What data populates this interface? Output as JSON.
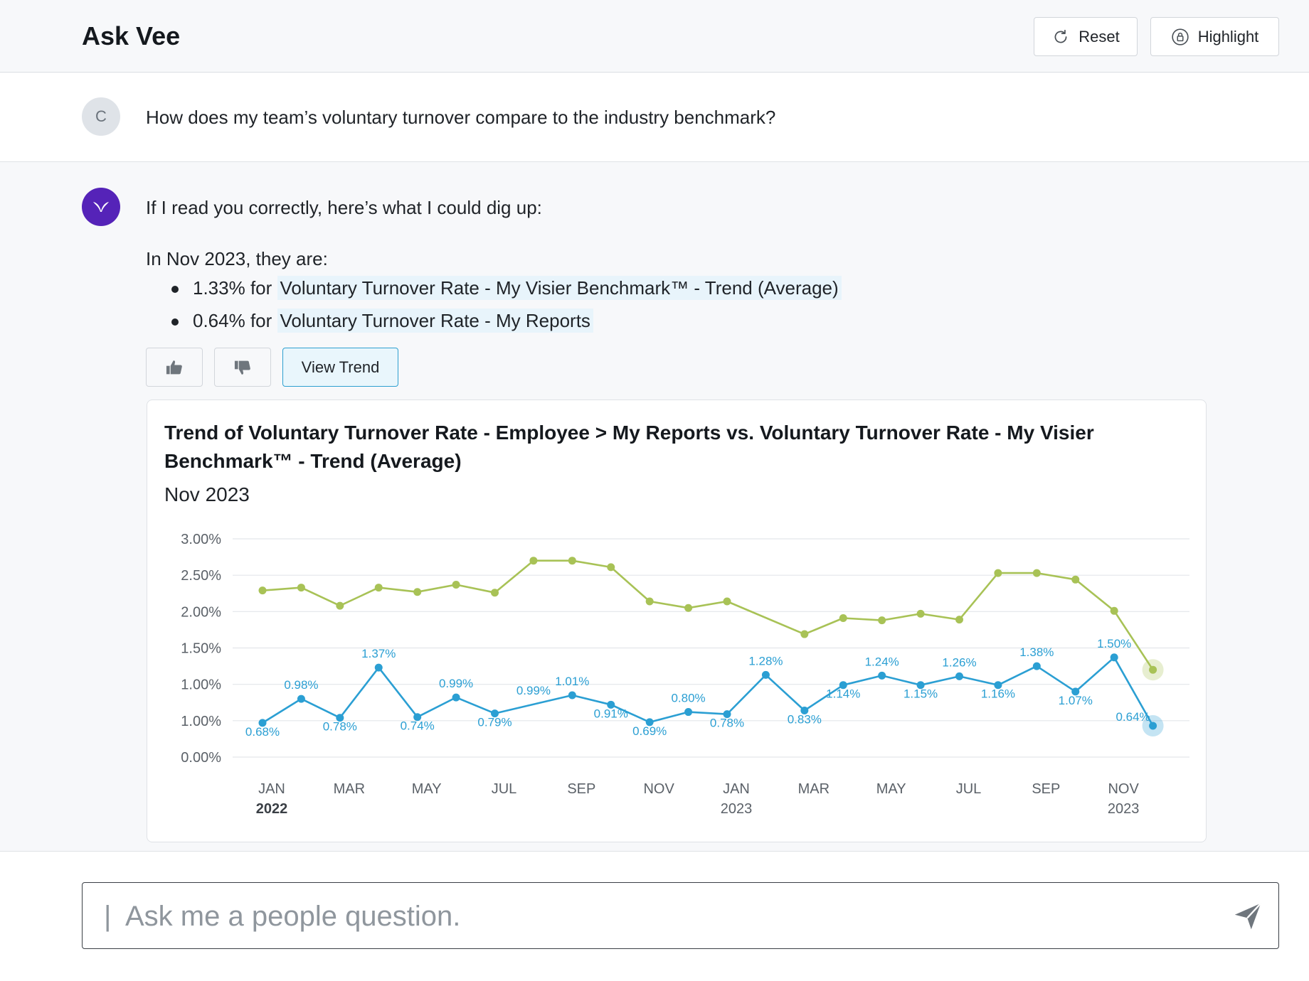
{
  "header": {
    "title": "Ask Vee",
    "reset_label": "Reset",
    "highlight_label": "Highlight"
  },
  "question": {
    "avatar_initial": "C",
    "text": "How does my team’s voluntary turnover compare to the industry benchmark?"
  },
  "answer": {
    "intro": "If I read you correctly, here’s what I could dig up:",
    "period_line": "In Nov 2023, they are:",
    "items": [
      {
        "value": "1.33% for ",
        "metric": "Voluntary Turnover Rate - My Visier Benchmark™ - Trend (Average)"
      },
      {
        "value": "0.64% for ",
        "metric": "Voluntary Turnover Rate - My Reports"
      }
    ],
    "view_trend_label": "View Trend"
  },
  "colors": {
    "benchmark": "#a8c256",
    "reports": "#2b9fd3",
    "brand": "#5523b8"
  },
  "icons": [
    "reset-icon",
    "lock-icon",
    "thumbs-up-icon",
    "thumbs-down-icon",
    "send-icon"
  ],
  "chart_data": {
    "type": "line",
    "title": "Trend of Voluntary Turnover Rate - Employee > My Reports vs. Voluntary Turnover Rate - My Visier Benchmark™ - Trend (Average)",
    "subtitle": "Nov 2023",
    "y_tick_labels": [
      "3.00%",
      "2.50%",
      "2.00%",
      "1.50%",
      "1.00%",
      "1.00%",
      "0.00%"
    ],
    "x_tick_labels": [
      {
        "month": "JAN",
        "year": "2022"
      },
      {
        "month": "MAR",
        "year": ""
      },
      {
        "month": "MAY",
        "year": ""
      },
      {
        "month": "JUL",
        "year": ""
      },
      {
        "month": "SEP",
        "year": ""
      },
      {
        "month": "NOV",
        "year": ""
      },
      {
        "month": "JAN",
        "year": "2023"
      },
      {
        "month": "MAR",
        "year": ""
      },
      {
        "month": "MAY",
        "year": ""
      },
      {
        "month": "JUL",
        "year": ""
      },
      {
        "month": "SEP",
        "year": ""
      },
      {
        "month": "NOV",
        "year": "2023"
      }
    ],
    "ylim": [
      0,
      3
    ],
    "grid": true,
    "series": [
      {
        "key": "benchmark",
        "values": [
          2.29,
          2.33,
          2.08,
          2.33,
          2.27,
          2.37,
          2.26,
          2.7,
          2.7,
          2.61,
          2.14,
          2.05,
          2.14,
          null,
          1.69,
          1.91,
          1.88,
          1.97,
          1.89,
          2.53,
          2.53,
          2.44,
          2.01,
          1.2
        ],
        "labels": null
      },
      {
        "key": "reports",
        "values": [
          0.47,
          0.8,
          0.54,
          1.23,
          0.55,
          0.82,
          0.6,
          null,
          0.85,
          0.72,
          0.48,
          0.62,
          0.59,
          1.13,
          0.64,
          0.99,
          1.12,
          0.99,
          1.11,
          0.99,
          1.25,
          0.9,
          1.37,
          0.43
        ],
        "labels": [
          "0.68%",
          "0.98%",
          "0.78%",
          "1.37%",
          "0.74%",
          "0.99%",
          "0.79%",
          "0.99%",
          "1.01%",
          "0.91%",
          "0.69%",
          "0.80%",
          "0.78%",
          "1.28%",
          "0.83%",
          "1.14%",
          "1.24%",
          "1.15%",
          "1.26%",
          "1.16%",
          "1.38%",
          "1.07%",
          "1.50%",
          "0.64%"
        ]
      }
    ]
  },
  "input": {
    "placeholder": "Ask me a people question.",
    "caret": "|"
  }
}
